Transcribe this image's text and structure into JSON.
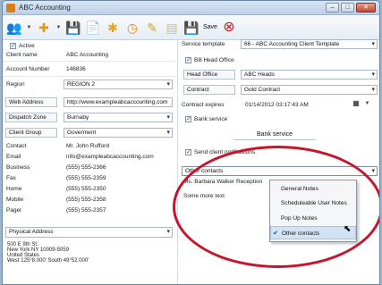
{
  "window": {
    "title": "ABC Accounting",
    "buttons": [
      "–",
      "□",
      "✕"
    ]
  },
  "toolbar": {
    "save_label": "Save"
  },
  "left": {
    "active_label": "Active",
    "fields": [
      {
        "label": "Client name",
        "value": "ABC Accounting"
      },
      {
        "label": "Account Number",
        "value": "146836"
      },
      {
        "label": "Region",
        "value": "REGION 2"
      },
      {
        "label": "Web Address",
        "value": "http://www.exampleabcaccounting.com"
      },
      {
        "label": "Dispatch Zone",
        "value": "Burnaby"
      },
      {
        "label": "Client Group",
        "value": "Goverment"
      }
    ],
    "contacts": [
      {
        "label": "Contact",
        "value": "Mr. John Rufford"
      },
      {
        "label": "Email",
        "value": "info@exampleabcaccounting.com"
      },
      {
        "label": "Business",
        "value": "(555) 555-2366"
      },
      {
        "label": "Fax",
        "value": "(555) 555-2359"
      },
      {
        "label": "Home",
        "value": "(555) 555-2350"
      },
      {
        "label": "Mobile",
        "value": "(555) 555-2358"
      },
      {
        "label": "Pager",
        "value": "(555) 555-2357"
      }
    ],
    "address_type": "Physical Address",
    "address_lines": [
      "500 E 9th St.",
      "New York NY  10009-5059",
      "United States",
      "West 125°8.000'  South 49°52.000'"
    ]
  },
  "right": {
    "service_template_label": "Service template",
    "service_template_value": "66 - ABC Accounting Client Template",
    "bill_head_office_label": "Bill Head Office",
    "head_office_label": "Head Office",
    "head_office_value": "ABC Heads",
    "contract_label": "Contract",
    "contract_value": "Gold Contract",
    "contract_expires_label": "Contract expires",
    "contract_expires_value": "01/14/2012 03:17:43 AM",
    "bank_service_check_label": "Bank service",
    "bank_service_button": "Bank service",
    "send_notifications_label": "Send client notifications",
    "contacts_dropdown_value": "Other contacts",
    "other_contact_name": "Ms. Barbara Walker Reception",
    "other_contact_text": "Some more text",
    "menu_items": [
      "General Notes",
      "Scheduleable User Notes",
      "Pop Up Notes",
      "Other contacts"
    ]
  }
}
